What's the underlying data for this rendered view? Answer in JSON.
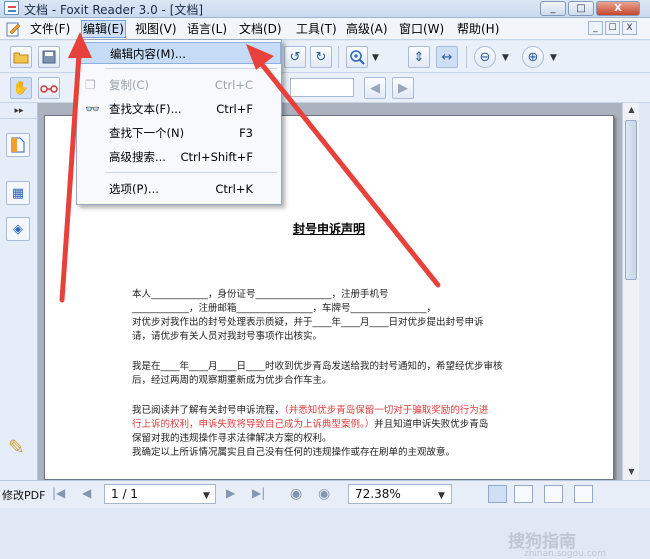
{
  "window": {
    "title": "文档 - Foxit Reader 3.0 - [文档]",
    "min": "_",
    "max": "□",
    "close": "X"
  },
  "menubar": {
    "items": [
      "文件(F)",
      "编辑(E)",
      "视图(V)",
      "语言(L)",
      "文档(D)",
      "工具(T)",
      "高级(A)",
      "窗口(W)",
      "帮助(H)"
    ],
    "mdi": [
      "_",
      "☐",
      "X"
    ]
  },
  "edit_menu": {
    "items": [
      {
        "label": "编辑内容(M)...",
        "shortcut": ""
      },
      {
        "label": "复制(C)",
        "shortcut": "Ctrl+C"
      },
      {
        "label": "查找文本(F)...",
        "shortcut": "Ctrl+F"
      },
      {
        "label": "查找下一个(N)",
        "shortcut": "F3"
      },
      {
        "label": "高级搜索...",
        "shortcut": "Ctrl+Shift+F"
      },
      {
        "label": "选项(P)...",
        "shortcut": "Ctrl+K"
      }
    ]
  },
  "document": {
    "title": "封号申诉声明",
    "lines": [
      "本人____________，身份证号________________，注册手机号",
      "____________，注册邮箱________________，车牌号________________，",
      "对优步对我作出的封号处理表示质疑，并于____年____月____日对优步提出封号申诉",
      "请，请优步有关人员对我封号事项作出核实。",
      "我是在____年____月____日____时收到优步青岛发送给我的封号通知的，希望经优步审核",
      "后，经过两周的观察期重新成为优步合作车主。",
      "我已阅读并了解有关封号申诉流程，",
      "（并悉知优步青岛保留一切对于骗取奖励的行为进",
      "行上诉的权利，申诉失败将导致自己成为上诉典型案例。）",
      "并且知道申诉失败优步青岛",
      "保留对我的违规操作寻求法律解决方案的权利。",
      "我确定以上所诉情况属实且自己没有任何的违规操作或存在刷单的主观故意。"
    ]
  },
  "watermark": {
    "brand": "搜狗指南",
    "url": "zhinan.sogou.com"
  },
  "statusbar": {
    "label": "修改PDF",
    "page": "1 / 1",
    "zoom": "72.38%"
  },
  "colors": {
    "accent": "#2d65b8",
    "annotation": "#e8403a",
    "highlight": "#c5dbf6"
  }
}
